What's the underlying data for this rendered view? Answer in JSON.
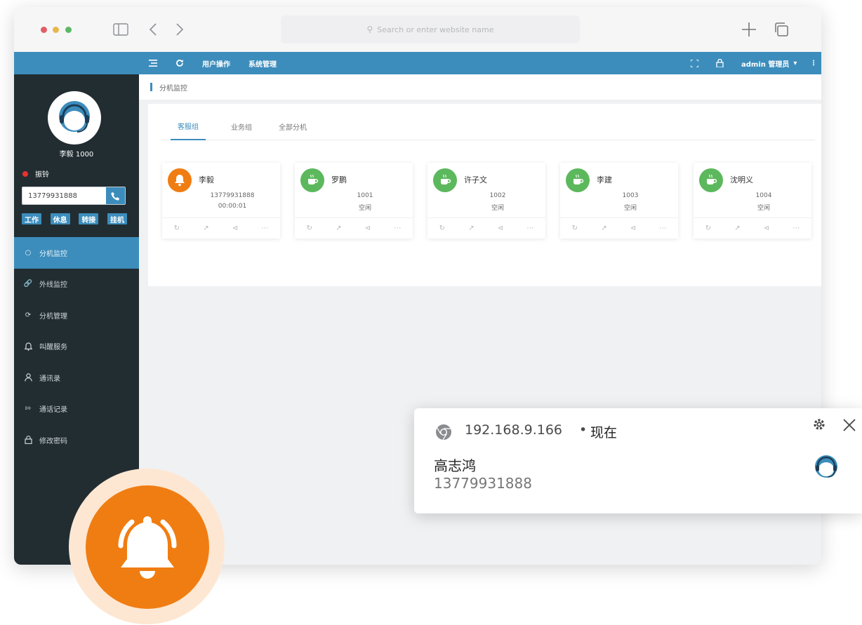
{
  "browser": {
    "url_placeholder": "Search or enter website name"
  },
  "topbar": {
    "menu_user_ops": "用户操作",
    "menu_system": "系统管理",
    "user": "admin 管理员"
  },
  "sidebar": {
    "agent_name": "李毅 1000",
    "status_label": "振铃",
    "phone_value": "13779931888",
    "buttons": [
      "工作",
      "休息",
      "转接",
      "挂机"
    ],
    "menu": [
      {
        "label": "分机监控",
        "icon": "monitor-icon"
      },
      {
        "label": "外线监控",
        "icon": "link-icon"
      },
      {
        "label": "分机管理",
        "icon": "extension-icon"
      },
      {
        "label": "叫醒服务",
        "icon": "bell-icon"
      },
      {
        "label": "通讯录",
        "icon": "person-icon"
      },
      {
        "label": "通话记录",
        "icon": "record-icon"
      },
      {
        "label": "修改密码",
        "icon": "lock-icon"
      }
    ]
  },
  "breadcrumb": "分机监控",
  "tabs": [
    "客服组",
    "业务组",
    "全部分机"
  ],
  "extensions": [
    {
      "name": "李毅",
      "line1": "13779931888",
      "line2": "00:00:01",
      "status": "ringing"
    },
    {
      "name": "罗鹏",
      "line1": "1001",
      "line2": "空闲",
      "status": "idle"
    },
    {
      "name": "许子文",
      "line1": "1002",
      "line2": "空闲",
      "status": "idle"
    },
    {
      "name": "李建",
      "line1": "1003",
      "line2": "空闲",
      "status": "idle"
    },
    {
      "name": "沈明义",
      "line1": "1004",
      "line2": "空闲",
      "status": "idle"
    }
  ],
  "notification": {
    "source": "192.168.9.166",
    "separator": "•",
    "time": "现在",
    "title": "高志鸿",
    "body": "13779931888"
  },
  "colors": {
    "accent": "#3c8dbc",
    "sidebar": "#222d32",
    "ringing": "#f07d12",
    "idle": "#5cb85c"
  }
}
